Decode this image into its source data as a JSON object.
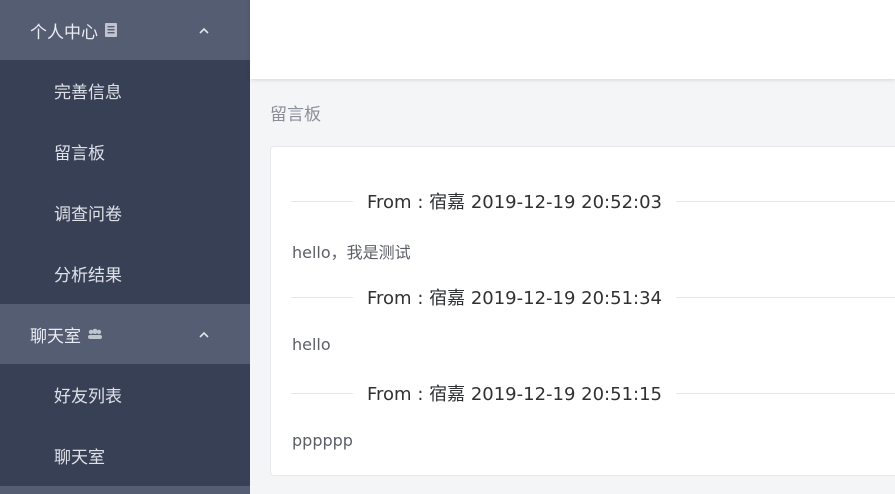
{
  "sidebar": {
    "groups": [
      {
        "label": "个人中心",
        "icon": "document-icon",
        "items": [
          "完善信息",
          "留言板",
          "调查问卷",
          "分析结果"
        ]
      },
      {
        "label": "聊天室",
        "icon": "group-icon",
        "items": [
          "好友列表",
          "聊天室"
        ]
      }
    ]
  },
  "breadcrumb": "留言板",
  "messages": [
    {
      "header": "From : 宿嘉   2019-12-19 20:52:03",
      "body": "hello，我是测试"
    },
    {
      "header": "From : 宿嘉   2019-12-19 20:51:34",
      "body": "hello"
    },
    {
      "header": "From : 宿嘉   2019-12-19 20:51:15",
      "body": "pppppp"
    }
  ],
  "colors": {
    "sidebar_bg": "#384055",
    "group_header_bg": "#555d72",
    "page_bg": "#f4f5f7"
  }
}
